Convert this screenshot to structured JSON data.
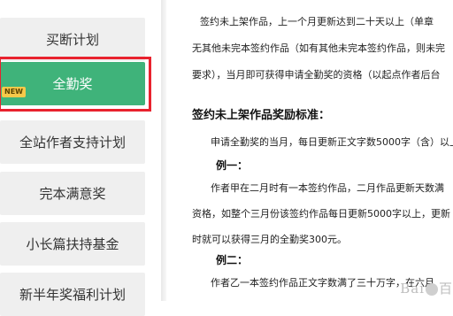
{
  "sidebar": {
    "items": [
      {
        "label": "买断计划"
      },
      {
        "label": "全勤奖",
        "badge": "NEW"
      },
      {
        "label": "全站作者支持计划"
      },
      {
        "label": "完本满意奖"
      },
      {
        "label": "小长篇扶持基金"
      },
      {
        "label": "新半年奖福利计划"
      }
    ]
  },
  "article": {
    "p1": [
      "签约未上架作品，上一个月更新达到二十天以上（单章",
      "无其他未完本签约作品（如有其他未完本签约作品，则未完",
      "要求），当月即可获得申请全勤奖的资格（以起点作者后台"
    ],
    "section_heading": "签约未上架作品奖励标准：",
    "p2": "申请全勤奖的当月，每日更新正文字数5000字（含）以上",
    "example1_heading": "例一：",
    "example1": [
      "作者甲在二月时有一本签约作品，二月作品更新天数满",
      "资格，如整个三月份该签约作品每日更新5000字以上，更新",
      "时就可以获得三月的全勤奖300元。"
    ],
    "example2_heading": "例二：",
    "example2": "作者乙一本签约作品正文字数满了三十万字，在六月"
  },
  "watermark": {
    "text": "Bai",
    "suffix": "百"
  },
  "colors": {
    "active_bg": "#3fb37a",
    "highlight": "#e8222e",
    "badge": "#f6c94a",
    "nav_bg": "#efefef"
  }
}
